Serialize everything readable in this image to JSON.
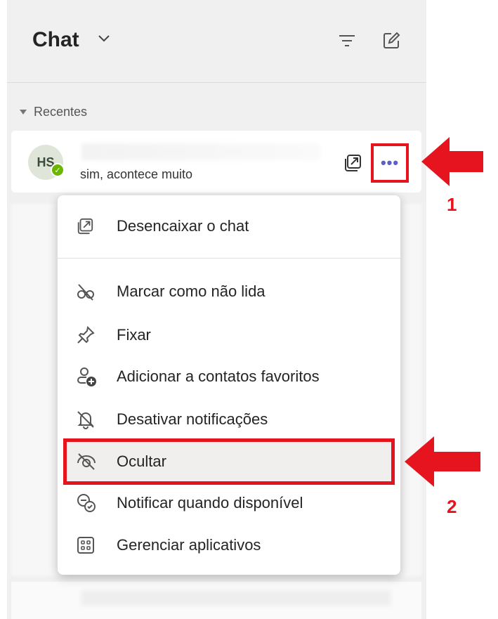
{
  "header": {
    "title": "Chat",
    "filter_icon": "filter-icon",
    "compose_icon": "compose-icon"
  },
  "section": {
    "label": "Recentes"
  },
  "chat_item": {
    "initials": "HS",
    "preview": "sim, acontece muito",
    "presence": "available",
    "more_label": "•••"
  },
  "menu": {
    "items": [
      {
        "label": "Desencaixar o chat",
        "icon": "pop-out-icon"
      },
      {
        "label": "Marcar como não lida",
        "icon": "unread-icon"
      },
      {
        "label": "Fixar",
        "icon": "pin-icon"
      },
      {
        "label": "Adicionar a contatos favoritos",
        "icon": "add-contact-icon"
      },
      {
        "label": "Desativar notificações",
        "icon": "bell-off-icon"
      },
      {
        "label": "Ocultar",
        "icon": "eye-off-icon",
        "highlighted": true
      },
      {
        "label": "Notificar quando disponível",
        "icon": "notify-available-icon"
      },
      {
        "label": "Gerenciar aplicativos",
        "icon": "apps-icon"
      }
    ]
  },
  "annotations": {
    "step1": "1",
    "step2": "2",
    "color": "#e5141e"
  }
}
